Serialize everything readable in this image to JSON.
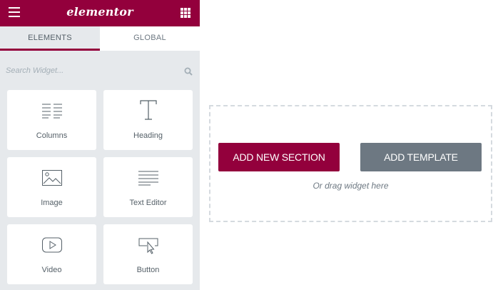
{
  "header": {
    "logo_text": "elementor",
    "menu_icon": "hamburger-icon",
    "apps_icon": "grid-icon",
    "brand_color": "#93003c"
  },
  "tabs": [
    {
      "label": "ELEMENTS",
      "active": true
    },
    {
      "label": "GLOBAL",
      "active": false
    }
  ],
  "search": {
    "placeholder": "Search Widget...",
    "value": ""
  },
  "widgets": [
    {
      "label": "Columns",
      "icon": "columns-icon"
    },
    {
      "label": "Heading",
      "icon": "heading-icon"
    },
    {
      "label": "Image",
      "icon": "image-icon"
    },
    {
      "label": "Text Editor",
      "icon": "text-editor-icon"
    },
    {
      "label": "Video",
      "icon": "video-icon"
    },
    {
      "label": "Button",
      "icon": "button-icon"
    }
  ],
  "canvas": {
    "add_section_label": "ADD NEW SECTION",
    "add_template_label": "ADD TEMPLATE",
    "drag_hint": "Or drag widget here",
    "secondary_color": "#6d7882"
  }
}
